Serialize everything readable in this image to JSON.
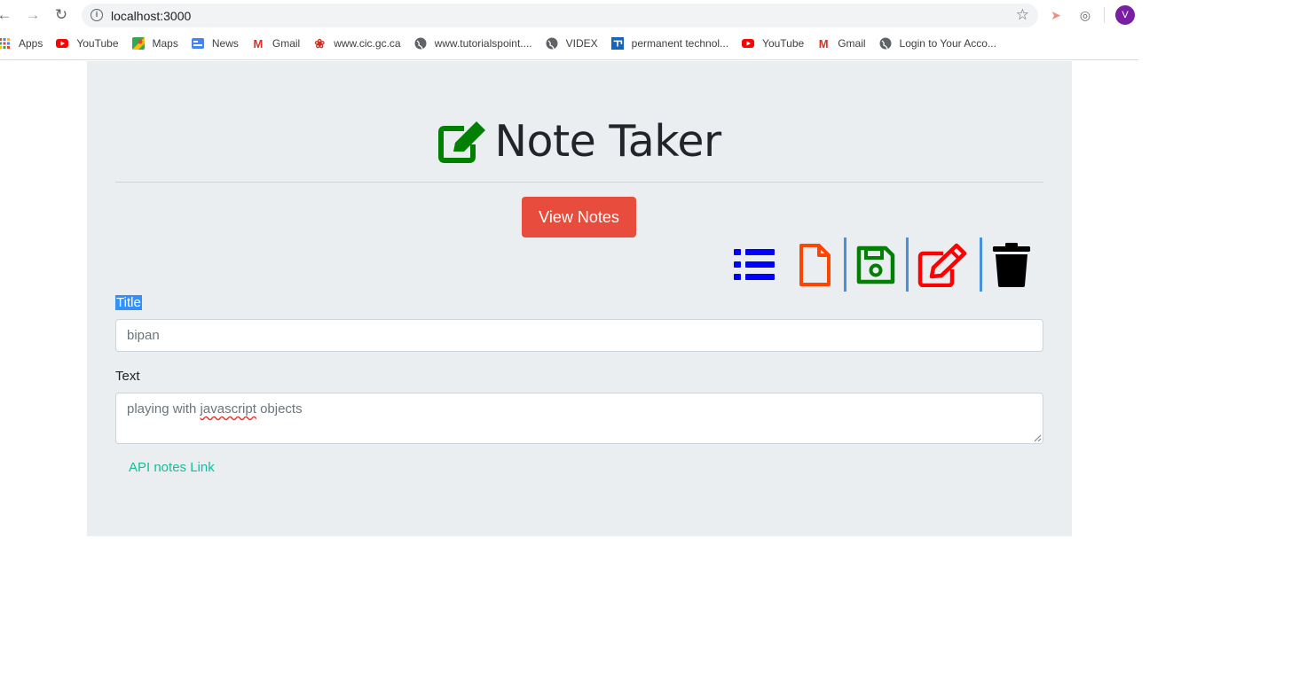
{
  "browser": {
    "url": "localhost:3000",
    "avatar_letter": "V",
    "bookmarks": [
      {
        "label": "Apps",
        "icon": "apps-grid-icon"
      },
      {
        "label": "YouTube",
        "icon": "youtube-icon"
      },
      {
        "label": "Maps",
        "icon": "maps-icon"
      },
      {
        "label": "News",
        "icon": "news-icon"
      },
      {
        "label": "Gmail",
        "icon": "gmail-icon"
      },
      {
        "label": "www.cic.gc.ca",
        "icon": "maple-leaf-icon"
      },
      {
        "label": "www.tutorialspoint....",
        "icon": "globe-icon"
      },
      {
        "label": "VIDEX",
        "icon": "globe-icon"
      },
      {
        "label": "permanent technol...",
        "icon": "site-icon"
      },
      {
        "label": "YouTube",
        "icon": "youtube-icon"
      },
      {
        "label": "Gmail",
        "icon": "gmail-icon"
      },
      {
        "label": "Login to Your Acco...",
        "icon": "globe-icon"
      }
    ]
  },
  "page": {
    "title": "Note Taker",
    "view_notes_label": "View Notes",
    "toolbar_icons": [
      "list-icon",
      "new-file-icon",
      "save-icon",
      "edit-icon",
      "trash-icon"
    ],
    "colors": {
      "list": "#0000ff",
      "new": "#ff4500",
      "save": "#008000",
      "edit": "#ff0000",
      "trash": "#000000",
      "title_icon": "#008000",
      "button": "#e74c3c",
      "link": "#18bc9c"
    },
    "title_label": "Title",
    "title_value": "bipan",
    "text_label": "Text",
    "text_value_pre": "playing with ",
    "text_value_misspelled": "javascript",
    "text_value_post": " objects",
    "api_link": "API notes Link"
  }
}
